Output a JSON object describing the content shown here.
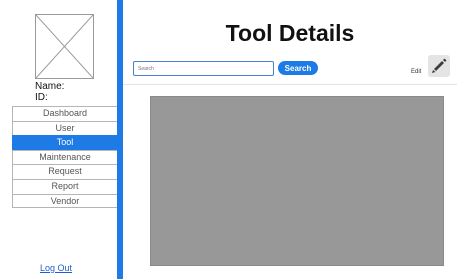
{
  "sidebar": {
    "name_label": "Name:",
    "id_label": "ID:",
    "items": [
      {
        "label": "Dashboard"
      },
      {
        "label": "User"
      },
      {
        "label": "Tool"
      },
      {
        "label": "Maintenance"
      },
      {
        "label": "Request"
      },
      {
        "label": "Report"
      },
      {
        "label": "Vendor"
      }
    ],
    "active_item": "Tool",
    "logout_label": "Log Out"
  },
  "header": {
    "title": "Tool Details"
  },
  "search": {
    "placeholder": "Search",
    "button_label": "Search"
  },
  "edit": {
    "label": "Edit",
    "icon": "pencil-icon"
  },
  "colors": {
    "accent": "#1e7be6",
    "content_placeholder": "#989898"
  }
}
